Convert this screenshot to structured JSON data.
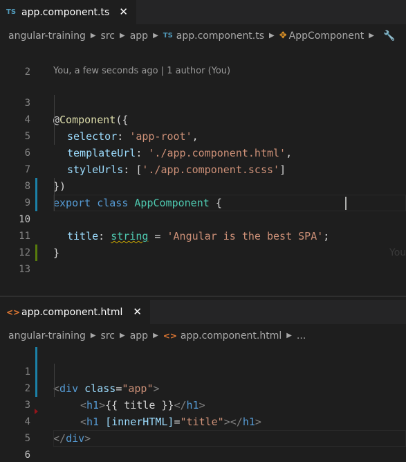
{
  "top_editor": {
    "tab": {
      "icon_text": "TS",
      "label": "app.component.ts",
      "close": "✕"
    },
    "breadcrumb": {
      "items": [
        "angular-training",
        "src",
        "app"
      ],
      "file_icon": "TS",
      "file": "app.component.ts",
      "symbol_icon": "class-icon",
      "symbol": "AppComponent",
      "tail_icon": "wrench-icon"
    },
    "codelens": "You, a few seconds ago | 1 author (You)",
    "inline_blame": "You",
    "line_numbers": [
      "2",
      "3",
      "4",
      "5",
      "6",
      "7",
      "8",
      "9",
      "10",
      "11",
      "12",
      "13"
    ],
    "lines": {
      "l3_at": "@",
      "l3_decor": "Component",
      "l3_rest": "({",
      "l4_key": "selector",
      "l4_colon": ": ",
      "l4_val": "'app-root'",
      "l4_end": ",",
      "l5_key": "templateUrl",
      "l5_colon": ": ",
      "l5_val": "'./app.component.html'",
      "l5_end": ",",
      "l6_key": "styleUrls",
      "l6_colon": ": [",
      "l6_val": "'./app.component.scss'",
      "l6_end": "]",
      "l7": "})",
      "l8_kw1": "export",
      "l8_kw2": "class",
      "l8_name": "AppComponent",
      "l8_brace": "{",
      "l10_key": "title",
      "l10_colon": ": ",
      "l10_type": "string",
      "l10_eq": " = ",
      "l10_val": "'Angular is the best SPA'",
      "l10_end": ";",
      "l11": "}"
    }
  },
  "bottom_editor": {
    "tab": {
      "icon_text": "<>",
      "label": "app.component.html",
      "close": "✕"
    },
    "breadcrumb": {
      "items": [
        "angular-training",
        "src",
        "app"
      ],
      "file_icon": "<>",
      "file": "app.component.html",
      "ellipsis": "..."
    },
    "line_numbers": [
      "1",
      "2",
      "3",
      "4",
      "5",
      "6"
    ],
    "lines": {
      "l1_open": "<",
      "l1_tag": "div",
      "l1_attr": " class",
      "l1_eq": "=",
      "l1_val": "\"app\"",
      "l1_close": ">",
      "l2_open": "<",
      "l2_tag": "h1",
      "l2_close": ">",
      "l2_text": "{{ title }}",
      "l2_end_open": "</",
      "l2_end_tag": "h1",
      "l2_end_close": ">",
      "l3_open": "<",
      "l3_tag": "h1",
      "l3_attr": " [innerHTML]",
      "l3_eq": "=",
      "l3_val": "\"title\"",
      "l3_close": ">",
      "l3_end_open": "</",
      "l3_end_tag": "h1",
      "l3_end_close": ">",
      "l4_open": "</",
      "l4_tag": "div",
      "l4_close": ">"
    }
  },
  "colors": {
    "background": "#1e1e1e",
    "tab_bar": "#252526",
    "keyword": "#569cd6",
    "string": "#ce9178",
    "property": "#9cdcfe",
    "class_name": "#4ec9b0",
    "decorator": "#dcdcaa",
    "gutter_modified": "#1b81a8",
    "gutter_added": "#587c0c"
  }
}
